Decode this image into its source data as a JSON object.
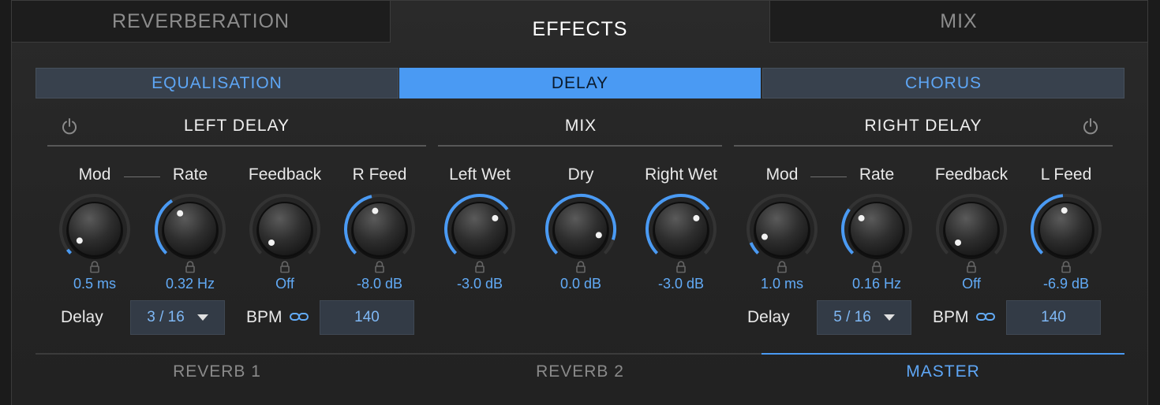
{
  "top_tabs": [
    {
      "label": "REVERBERATION",
      "active": false
    },
    {
      "label": "EFFECTS",
      "active": true
    },
    {
      "label": "MIX",
      "active": false
    }
  ],
  "sub_tabs": [
    {
      "label": "EQUALISATION",
      "active": false
    },
    {
      "label": "DELAY",
      "active": true
    },
    {
      "label": "CHORUS",
      "active": false
    }
  ],
  "sections": {
    "left_delay": "LEFT DELAY",
    "mix": "MIX",
    "right_delay": "RIGHT DELAY"
  },
  "knobs": [
    {
      "label": "Mod",
      "value": "0.5 ms",
      "level": 0.03
    },
    {
      "label": "Rate",
      "value": "0.32 Hz",
      "level": 0.38
    },
    {
      "label": "Feedback",
      "value": "Off",
      "level": 0.0
    },
    {
      "label": "R Feed",
      "value": "-8.0 dB",
      "level": 0.45
    },
    {
      "label": "Left Wet",
      "value": "-3.0 dB",
      "level": 0.7
    },
    {
      "label": "Dry",
      "value": "0.0 dB",
      "level": 0.9
    },
    {
      "label": "Right Wet",
      "value": "-3.0 dB",
      "level": 0.7
    },
    {
      "label": "Mod",
      "value": "1.0 ms",
      "level": 0.08
    },
    {
      "label": "Rate",
      "value": "0.16 Hz",
      "level": 0.3
    },
    {
      "label": "Feedback",
      "value": "Off",
      "level": 0.0
    },
    {
      "label": "L Feed",
      "value": "-6.9 dB",
      "level": 0.48
    }
  ],
  "left_controls": {
    "delay_label": "Delay",
    "delay_value": "3 / 16",
    "bpm_label": "BPM",
    "bpm_value": "140"
  },
  "right_controls": {
    "delay_label": "Delay",
    "delay_value": "5 / 16",
    "bpm_label": "BPM",
    "bpm_value": "140"
  },
  "bottom_tabs": [
    {
      "label": "REVERB 1",
      "active": false
    },
    {
      "label": "REVERB 2",
      "active": false
    },
    {
      "label": "MASTER",
      "active": true
    }
  ],
  "colors": {
    "accent": "#4a9af3",
    "value_text": "#62abf7"
  }
}
